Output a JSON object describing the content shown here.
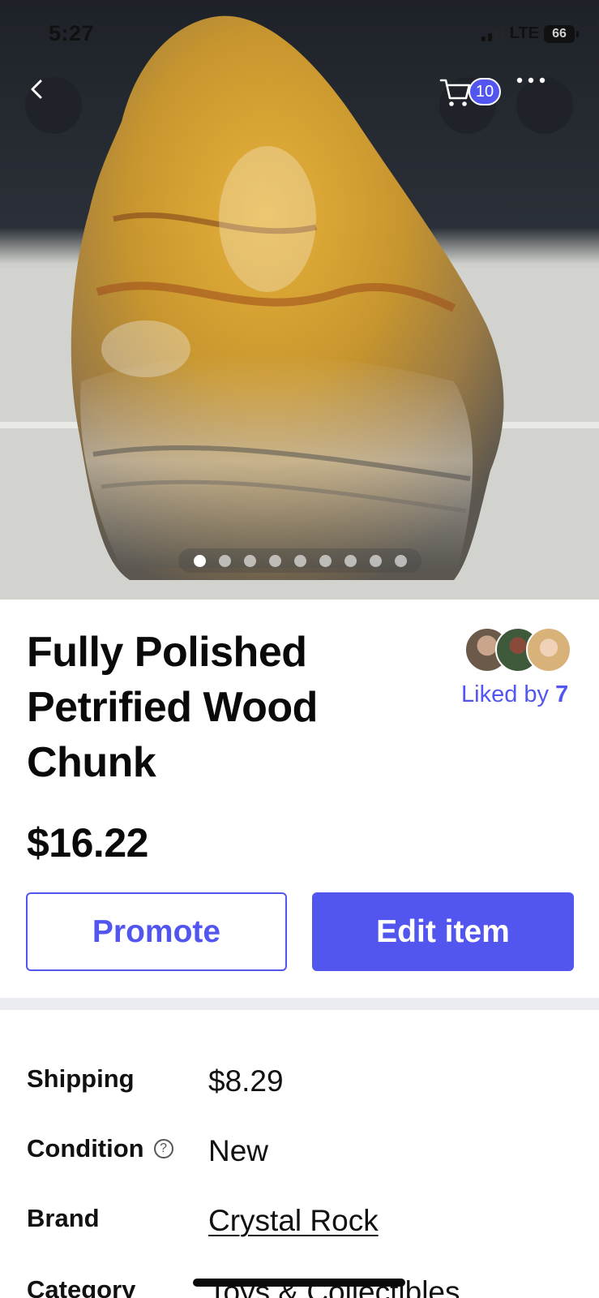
{
  "status_bar": {
    "time": "5:27",
    "network": "LTE",
    "battery": "66"
  },
  "nav": {
    "cart_count": "10"
  },
  "gallery": {
    "image_count": 9,
    "active_index": 0
  },
  "product": {
    "title": "Fully Polished Petrified Wood Chunk",
    "price": "$16.22",
    "liked_prefix": "Liked by",
    "liked_count": "7"
  },
  "actions": {
    "promote_label": "Promote",
    "edit_label": "Edit item"
  },
  "details": [
    {
      "label": "Shipping",
      "value": "$8.29"
    },
    {
      "label": "Condition",
      "value": "New"
    },
    {
      "label": "Brand",
      "value": "Crystal Rock"
    },
    {
      "label": "Category",
      "value": "Toys & Collectibles"
    }
  ],
  "colors": {
    "accent": "#5356ee",
    "divider": "#ebecf1"
  },
  "icons": {
    "back": "chevron-left-icon",
    "cart": "cart-icon",
    "more": "more-horizontal-icon",
    "help": "question-circle-icon"
  }
}
